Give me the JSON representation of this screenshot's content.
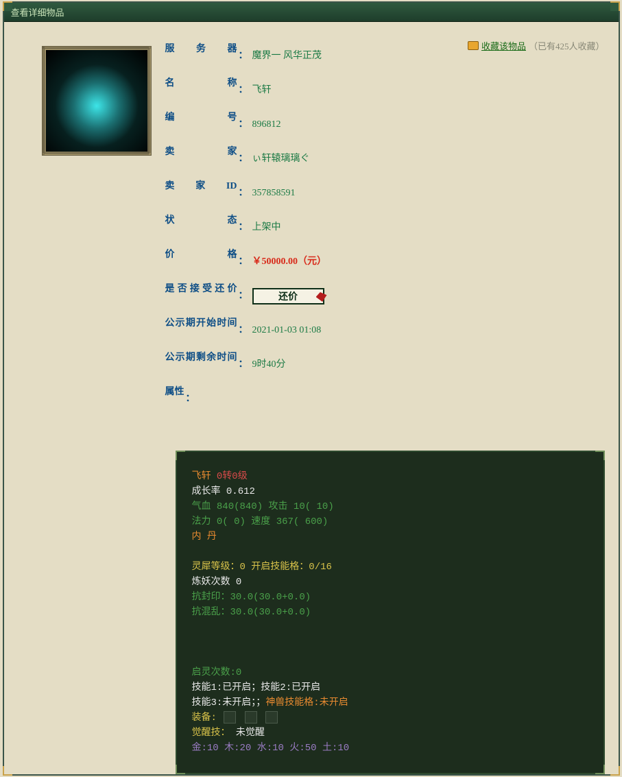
{
  "window": {
    "title": "查看详细物品"
  },
  "favorite": {
    "link_text": "收藏该物品",
    "count_text": "（已有425人收藏）"
  },
  "info": {
    "server_label": "服务器",
    "server_value": "魔界一  风华正茂",
    "name_label": "名称",
    "name_value": "飞轩",
    "id_label": "编号",
    "id_value": "896812",
    "seller_label": "卖家",
    "seller_value": "ぃ轩辕璃璃ぐ",
    "seller_id_label": "卖家ID",
    "seller_id_value": "357858591",
    "status_label": "状态",
    "status_value": "上架中",
    "price_label": "价格",
    "price_value": "￥50000.00（元）",
    "bargain_label": "是否接受还价",
    "bargain_btn": "还价",
    "pub_start_label": "公示期开始时间",
    "pub_start_value": "2021-01-03 01:08",
    "pub_remain_label": "公示期剩余时间",
    "pub_remain_value": "9时40分",
    "attr_label": "属性"
  },
  "stats": {
    "name": "飞轩",
    "rank": "0转0级",
    "growth_label": "成长率",
    "growth_value": "0.612",
    "hp_line": "气血 840(840) 攻击 10( 10)",
    "mp_line": "法力 0( 0) 速度 367( 600)",
    "neidan": "内 丹",
    "lingxi_line": "灵犀等级：0 开启技能格：0/16",
    "lianyao_line": "炼妖次数 0",
    "kangfeng_line": "抗封印：30.0(30.0+0.0)",
    "kanghun_line": "抗混乱：30.0(30.0+0.0)",
    "qiling_line": "启灵次数:0",
    "skill_line1": "技能1:已开启；技能2:已开启",
    "skill_line2_a": "技能3:未开启；；",
    "skill_line2_b": "神兽技能格:未开启",
    "equip_label": "装备:",
    "awaken_label": "觉醒技：",
    "awaken_value": "未觉醒",
    "elements": {
      "jin": "金:10",
      "mu": "木:20",
      "shui": "水:10",
      "huo": "火:50",
      "tu": "土:10"
    }
  }
}
